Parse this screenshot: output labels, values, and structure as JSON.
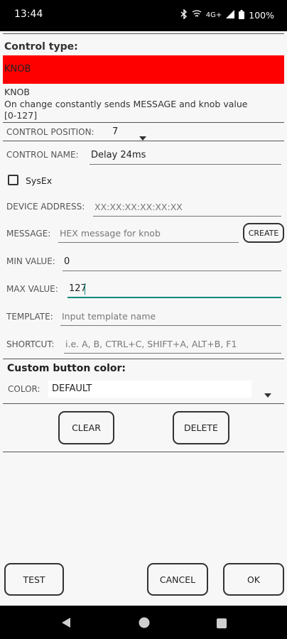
{
  "status": {
    "time": "13:44",
    "network": "4G+",
    "battery": "100%"
  },
  "control_type": {
    "heading": "Control type:",
    "selected": "KNOB",
    "color": "#ff0000",
    "desc_title": "KNOB",
    "desc_line1": "On change constantly sends MESSAGE and knob value",
    "desc_line2": "[0-127]"
  },
  "position": {
    "label": "CONTROL POSITION:",
    "value": "7"
  },
  "name": {
    "label": "CONTROL NAME:",
    "value": "Delay 24ms"
  },
  "sysex": {
    "label": "SysEx",
    "checked": false
  },
  "device": {
    "label": "DEVICE ADDRESS:",
    "placeholder": "XX:XX:XX:XX:XX:XX"
  },
  "message": {
    "label": "MESSAGE:",
    "placeholder": "HEX message for knob",
    "create_label": "CREATE"
  },
  "min": {
    "label": "MIN VALUE:",
    "value": "0"
  },
  "max": {
    "label": "MAX VALUE:",
    "value": "127",
    "accent": "#00897b"
  },
  "template": {
    "label": "TEMPLATE:",
    "placeholder": "Input template name"
  },
  "shortcut": {
    "label": "SHORTCUT:",
    "placeholder": "i.e. A, B, CTRL+C, SHIFT+A, ALT+B, F1"
  },
  "custom_color": {
    "heading": "Custom button color:",
    "label": "COLOR:",
    "value": "DEFAULT"
  },
  "actions": {
    "clear": "CLEAR",
    "delete": "DELETE"
  },
  "footer": {
    "test": "TEST",
    "cancel": "CANCEL",
    "ok": "OK"
  }
}
